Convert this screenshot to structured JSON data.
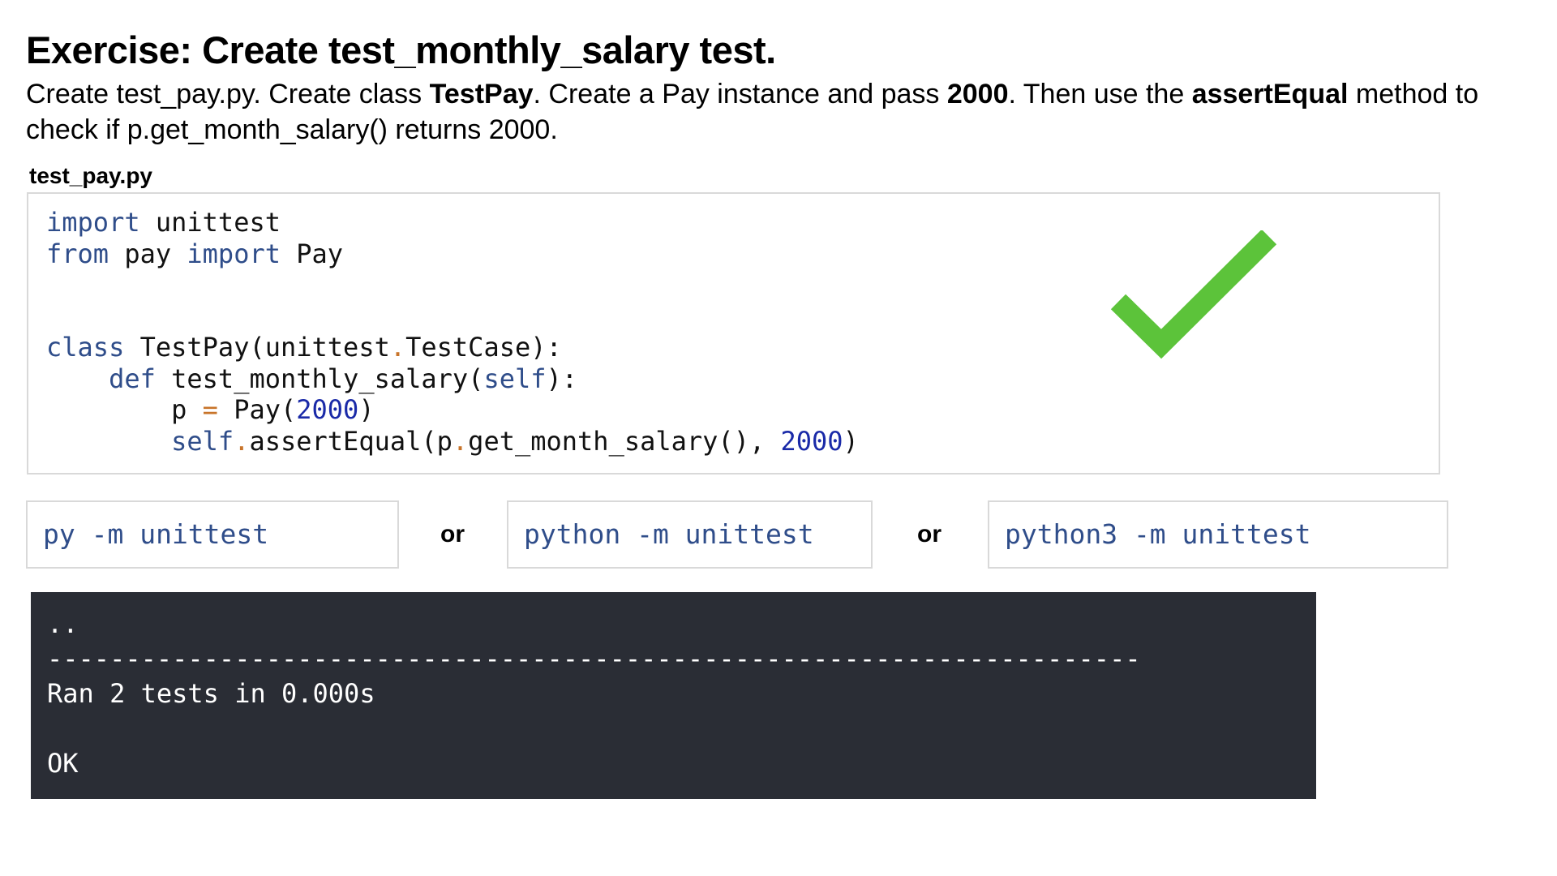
{
  "title": "Exercise: Create test_monthly_salary test.",
  "instructions": {
    "part1": "Create test_pay.py. Create class ",
    "bold1": "TestPay",
    "part2": ". Create a Pay instance and pass ",
    "bold2": "2000",
    "part3": ". Then use the ",
    "bold3": "assertEqual",
    "part4": " method to check if p.get_month_salary() returns 2000."
  },
  "file_label": "test_pay.py",
  "code": {
    "line1": {
      "kw": "import",
      "rest": " unittest"
    },
    "line2": {
      "kw1": "from",
      "mid": " pay ",
      "kw2": "import",
      "rest": " Pay"
    },
    "line3": {
      "kw": "class",
      "a": " TestPay(unittest",
      "op": ".",
      "b": "TestCase):"
    },
    "line4": {
      "indent": "    ",
      "kw": "def",
      "a": " test_monthly_salary(",
      "kw2": "self",
      "b": "):"
    },
    "line5": {
      "indent": "        ",
      "a": "p ",
      "op": "=",
      "b": " Pay(",
      "num": "2000",
      "c": ")"
    },
    "line6": {
      "indent": "        ",
      "kw": "self",
      "op1": ".",
      "a": "assertEqual(p",
      "op2": ".",
      "b": "get_month_salary(), ",
      "num": "2000",
      "c": ")"
    }
  },
  "commands": [
    {
      "text": "py -m unittest"
    },
    {
      "text": "python -m unittest"
    },
    {
      "text": "python3 -m unittest"
    }
  ],
  "separator": "or",
  "terminal": {
    "line1": "..",
    "line2": "----------------------------------------------------------------------",
    "line3": "Ran 2 tests in 0.000s",
    "line4": "",
    "line5": "OK"
  },
  "icons": {
    "checkmark": "checkmark-icon"
  },
  "colors": {
    "keyword": "#2f4d8a",
    "operator": "#c8742a",
    "number": "#1a2aa8",
    "checkmark": "#5cc33a",
    "terminal_bg": "#2a2d35"
  }
}
